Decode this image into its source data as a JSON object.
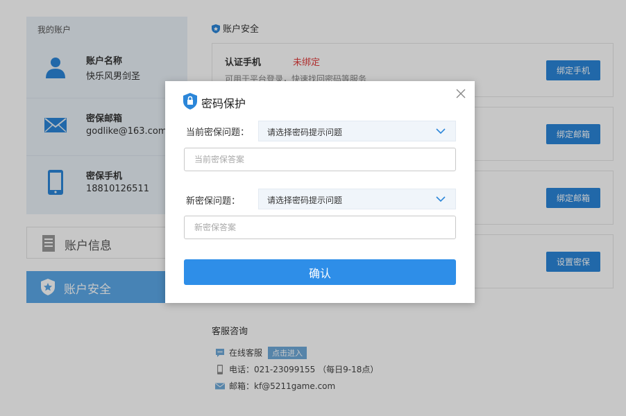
{
  "account": {
    "title": "我的账户",
    "rows": [
      {
        "label": "账户名称",
        "value": "快乐风男剑圣",
        "icon": "user-icon"
      },
      {
        "label": "密保邮箱",
        "value": "godlike@163.com",
        "icon": "mail-icon"
      },
      {
        "label": "密保手机",
        "value": "18810126511",
        "icon": "phone-icon"
      }
    ]
  },
  "nav": {
    "info_label": "账户信息",
    "security_label": "账户安全"
  },
  "security": {
    "heading": "账户安全",
    "cards": [
      {
        "title": "认证手机",
        "status": "未绑定",
        "desc": "可用于平台登录，快速找回密码等服务",
        "button": "绑定手机"
      },
      {
        "title": "",
        "status": "",
        "desc": "",
        "button": "绑定邮箱"
      },
      {
        "title": "",
        "status": "",
        "desc": "",
        "button": "绑定邮箱"
      },
      {
        "title": "",
        "status": "",
        "desc": "",
        "button": "设置密保"
      }
    ]
  },
  "service": {
    "title": "客服咨询",
    "online_label": "在线客服",
    "online_badge": "点击进入",
    "phone": "电话：021-23099155 （每日9-18点）",
    "email": "邮箱：kf@5211game.com"
  },
  "modal": {
    "title": "密码保护",
    "current_question_label": "当前密保问题：",
    "current_question_value": "请选择密码提示问题",
    "current_answer_placeholder": "当前密保答案",
    "new_question_label": "新密保问题：",
    "new_question_value": "请选择密码提示问题",
    "new_answer_placeholder": "新密保答案",
    "confirm_label": "确认"
  },
  "colors": {
    "accent": "#2e8ee8",
    "button_blue": "#2b86d9",
    "status_red": "#e03c3c",
    "nav_active": "#5ba8e8"
  }
}
